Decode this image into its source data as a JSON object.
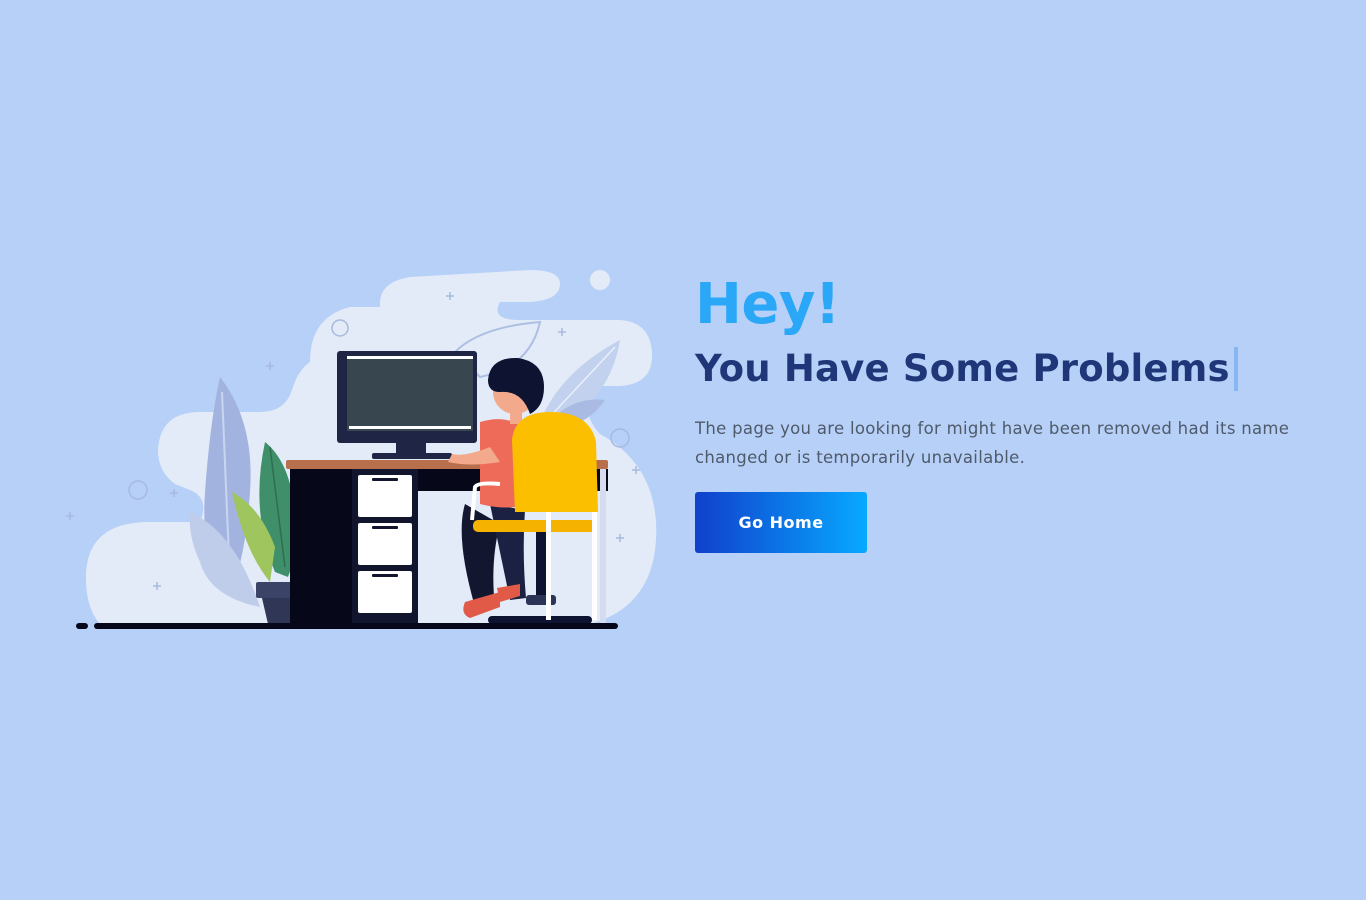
{
  "colors": {
    "background": "#b6d0f7",
    "accent_light": "#2aa7f7",
    "heading_dark": "#1f3778",
    "text_muted": "#4f5a6b",
    "button_start": "#1040cc",
    "button_end": "#07a9ff"
  },
  "error": {
    "greeting": "Hey!",
    "title": "You Have Some Problems",
    "description": "The page you are looking for might have been removed had its name changed or is temporarily unavailable.",
    "home_button_label": "Go Home"
  },
  "illustration": {
    "icon": "person-at-desk-computer-illustration"
  }
}
